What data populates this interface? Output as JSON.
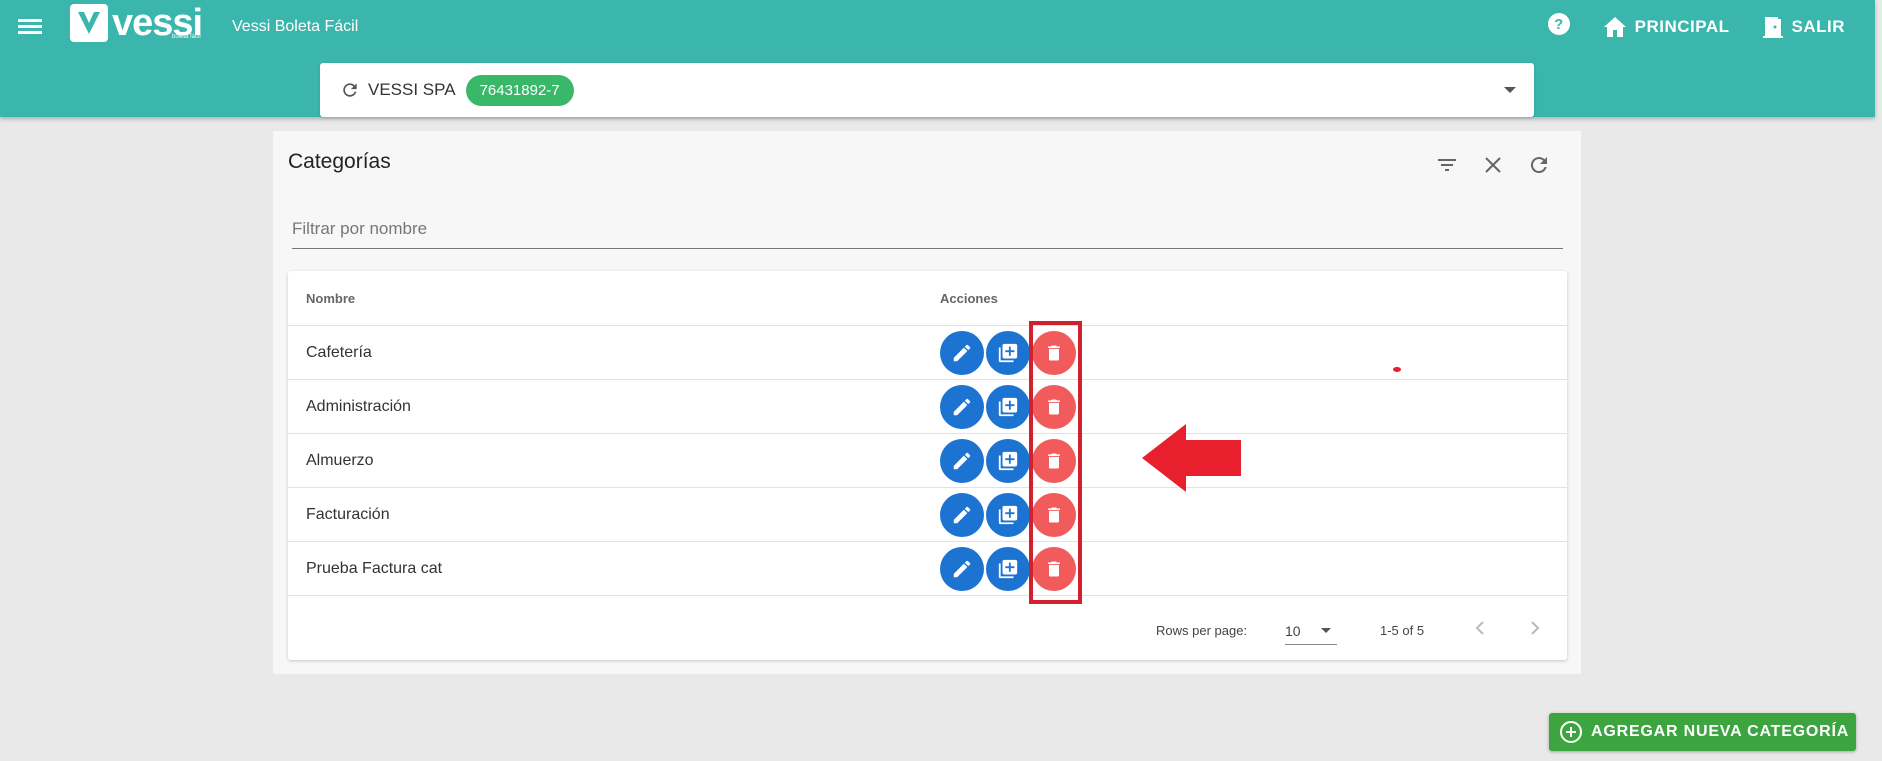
{
  "header": {
    "logo_text": "vessi",
    "logo_subtext": "boleta fácil",
    "app_name": "Vessi Boleta Fácil",
    "nav": {
      "home_label": "PRINCIPAL",
      "logout_label": "SALIR"
    }
  },
  "company": {
    "name": "VESSI SPA",
    "rut": "76431892-7"
  },
  "card": {
    "title": "Categorías",
    "filter_placeholder": "Filtrar por nombre",
    "filter_value": ""
  },
  "table": {
    "columns": [
      "Nombre",
      "Acciones"
    ],
    "rows": [
      {
        "name": "Cafetería"
      },
      {
        "name": "Administración"
      },
      {
        "name": "Almuerzo"
      },
      {
        "name": "Facturación"
      },
      {
        "name": "Prueba Factura cat"
      }
    ],
    "footer": {
      "rows_per_page_label": "Rows per page:",
      "rows_per_page": "10",
      "range": "1-5 of 5"
    }
  },
  "add_button_label": "AGREGAR NUEVA CATEGORÍA",
  "colors": {
    "header_teal": "#3ab6ad",
    "chip_green": "#3ab86a",
    "edit_blue": "#1c73d1",
    "delete_red": "#f15b5b",
    "annotation_red": "#d0212e",
    "add_green": "#3ca540"
  },
  "icons": {
    "row_actions": [
      "pencil-icon",
      "copy-plus-icon",
      "trash-icon"
    ],
    "card_tools": [
      "filter-icon",
      "close-icon",
      "refresh-icon"
    ]
  }
}
